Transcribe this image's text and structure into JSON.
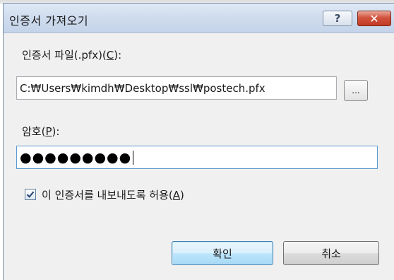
{
  "window": {
    "title": "인증서 가져오기",
    "help_label": "?",
    "close_label": "✕"
  },
  "file": {
    "label_prefix": "인증서 파일(.pfx)(",
    "label_key": "C",
    "label_suffix": "):",
    "path": "C:₩Users₩kimdh₩Desktop₩ssl₩postech.pfx",
    "browse_label": "..."
  },
  "password": {
    "label_prefix": "암호(",
    "label_key": "P",
    "label_suffix": "):",
    "masked_value": "●●●●●●●●●"
  },
  "export": {
    "checked": true,
    "label_prefix": "이 인증서를 내보내도록 허용(",
    "label_key": "A",
    "label_suffix": ")"
  },
  "buttons": {
    "ok_label": "확인",
    "cancel_label": "취소"
  }
}
